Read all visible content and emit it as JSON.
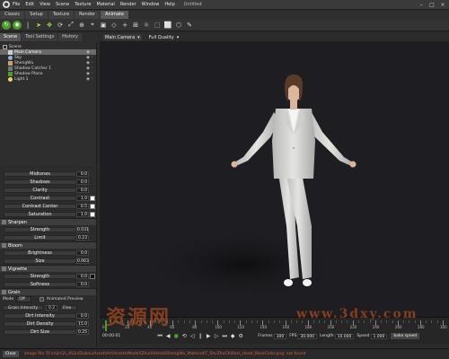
{
  "menubar": {
    "items": [
      "File",
      "Edit",
      "View",
      "Scene",
      "Texture",
      "Material",
      "Render",
      "Window",
      "Help"
    ],
    "title": "Untitled"
  },
  "mode_tabs": [
    "Classic",
    "Setup",
    "Texture",
    "Render",
    "Animate"
  ],
  "left_tabs": [
    "Scene",
    "Tool Settings",
    "History"
  ],
  "scene_tree": [
    {
      "label": "Scene",
      "indent": 0
    },
    {
      "label": "Main Camera",
      "indent": 1,
      "selected": true
    },
    {
      "label": "Sky",
      "indent": 1
    },
    {
      "label": "ShengWu",
      "indent": 1
    },
    {
      "label": "Shadow Catcher 1",
      "indent": 1
    },
    {
      "label": "Shadow Plane",
      "indent": 1
    },
    {
      "label": "Light 1",
      "indent": 1
    }
  ],
  "props": {
    "top": [
      {
        "label": "Midtones",
        "value": "0.0"
      },
      {
        "label": "Shadows",
        "value": "0.0"
      },
      {
        "label": "Clarity",
        "value": "0.0"
      },
      {
        "label": "Contrast",
        "value": "1.0"
      },
      {
        "label": "Contrast Center",
        "value": "0.5"
      },
      {
        "label": "Saturation",
        "value": "1.0"
      }
    ],
    "sharpen": {
      "title": "Sharpen",
      "rows": [
        {
          "label": "Strength",
          "value": "0.031"
        },
        {
          "label": "Limit",
          "value": "0.23"
        }
      ]
    },
    "bloom": {
      "title": "Bloom",
      "rows": [
        {
          "label": "Brightness",
          "value": "0.0"
        },
        {
          "label": "Size",
          "value": "0.063"
        }
      ]
    },
    "vignette": {
      "title": "Vignette",
      "rows": [
        {
          "label": "Strength",
          "value": "0.0"
        },
        {
          "label": "Softness",
          "value": "0.0"
        }
      ]
    },
    "grain": {
      "title": "Grain",
      "mode_label": "Mode",
      "mode_value": "Off",
      "animated_label": "Animated Preview",
      "grain_intensity_label": "Grain Intensity",
      "grain_intensity_value": "0.2",
      "grain_type": "Fine",
      "rows": [
        {
          "label": "Dirt Intensity",
          "value": "0.0"
        },
        {
          "label": "Dirt Density",
          "value": "15.0"
        },
        {
          "label": "Dirt Size",
          "value": "0.25"
        }
      ]
    }
  },
  "viewport": {
    "camera": "Main Camera",
    "quality": "Full Quality"
  },
  "timeline": {
    "ticks": [
      "0",
      "20",
      "40",
      "60",
      "80",
      "100",
      "120",
      "140",
      "160",
      "180",
      "200",
      "220",
      "240",
      "260",
      "280",
      "300"
    ],
    "time": "00:00:01",
    "frames_label": "Frames",
    "frames_value": "300",
    "fps_label": "FPS",
    "fps_value": "30.000",
    "length_label": "Length",
    "length_value": "10.000",
    "speed_label": "Speed",
    "speed_value": "1.000",
    "bake_button": "bake speed"
  },
  "console": {
    "clear_label": "Clear",
    "message": "image file 'D:\\mjin\\2\\_4\\Gu\\Dukou\\Asset\\Art\\Assets\\Model\\Zhuhl\\Head\\ShengWu_Material\\T_ShcZhuCh\\Res\\_Head_BaseColor.png' not found"
  },
  "watermarks": {
    "left": "资源网",
    "right": "www.3dxy.com"
  },
  "colors": {
    "accent_green": "#4b9e2a",
    "selection": "#6a6a6a",
    "viewport_bg": "#1e1d21",
    "error_text": "#e35b4b"
  }
}
